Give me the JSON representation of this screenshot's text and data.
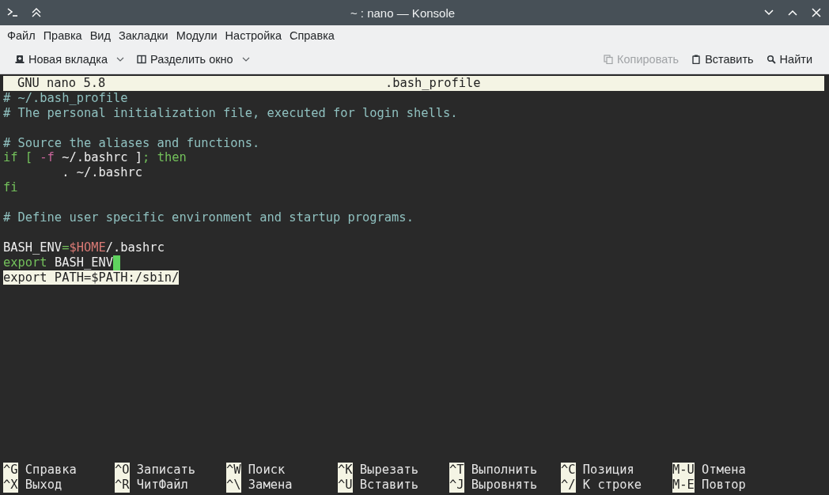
{
  "window": {
    "title": "~ : nano — Konsole"
  },
  "menu": [
    "Файл",
    "Правка",
    "Вид",
    "Закладки",
    "Модули",
    "Настройка",
    "Справка"
  ],
  "toolbar": {
    "left": [
      {
        "label": "Новая вкладка",
        "dropdown": true,
        "disabled": false
      },
      {
        "label": "Разделить окно",
        "dropdown": true,
        "disabled": false
      }
    ],
    "right": [
      {
        "label": "Копировать",
        "dropdown": false,
        "disabled": true
      },
      {
        "label": "Вставить",
        "dropdown": false,
        "disabled": false
      },
      {
        "label": "Найти",
        "dropdown": false,
        "disabled": false
      }
    ]
  },
  "nano": {
    "version": "GNU nano 5.8",
    "filename": ".bash_profile",
    "lines": [
      {
        "selected": false,
        "cursor": false,
        "segments": [
          {
            "kind": "comment",
            "text": "# ~/.bash_profile"
          }
        ]
      },
      {
        "selected": false,
        "cursor": false,
        "segments": [
          {
            "kind": "comment",
            "text": "# The personal initialization file, executed for login shells."
          }
        ]
      },
      {
        "selected": false,
        "cursor": false
      },
      {
        "selected": false,
        "cursor": false,
        "segments": [
          {
            "kind": "comment",
            "text": "# Source the aliases and functions."
          }
        ]
      },
      {
        "selected": false,
        "cursor": false,
        "segments": [
          {
            "kind": "keyword",
            "text": "if [ "
          },
          {
            "kind": "option",
            "text": "-f"
          },
          {
            "kind": "plain",
            "text": " ~/.bashrc ]"
          },
          {
            "kind": "keyword",
            "text": "; then"
          }
        ]
      },
      {
        "selected": false,
        "cursor": false,
        "segments": [
          {
            "kind": "plain",
            "text": "        . ~/.bashrc"
          }
        ]
      },
      {
        "selected": false,
        "cursor": false,
        "segments": [
          {
            "kind": "keyword",
            "text": "fi"
          }
        ]
      },
      {
        "selected": false,
        "cursor": false
      },
      {
        "selected": false,
        "cursor": false,
        "segments": [
          {
            "kind": "comment",
            "text": "# Define user specific environment and startup programs."
          }
        ]
      },
      {
        "selected": false,
        "cursor": false
      },
      {
        "selected": false,
        "cursor": false,
        "segments": [
          {
            "kind": "plain",
            "text": "BASH_ENV"
          },
          {
            "kind": "keyword",
            "text": "="
          },
          {
            "kind": "variable",
            "text": "$HOME"
          },
          {
            "kind": "plain",
            "text": "/.bashrc"
          }
        ]
      },
      {
        "selected": false,
        "cursor": true,
        "segments": [
          {
            "kind": "keyword",
            "text": "export"
          },
          {
            "kind": "plain",
            "text": " BASH_ENV"
          }
        ]
      },
      {
        "selected": true,
        "cursor": false,
        "segments": [
          {
            "kind": "plain",
            "text": "export PATH=$PATH:/sbin/"
          }
        ]
      }
    ],
    "shortcuts": [
      {
        "key": "^G",
        "label": "Справка"
      },
      {
        "key": "^O",
        "label": "Записать"
      },
      {
        "key": "^W",
        "label": "Поиск"
      },
      {
        "key": "^K",
        "label": "Вырезать"
      },
      {
        "key": "^T",
        "label": "Выполнить"
      },
      {
        "key": "^C",
        "label": "Позиция"
      },
      {
        "key": "M-U",
        "label": "Отмена"
      },
      {
        "key": "^X",
        "label": "Выход"
      },
      {
        "key": "^R",
        "label": "ЧитФайл"
      },
      {
        "key": "^\\",
        "label": "Замена"
      },
      {
        "key": "^U",
        "label": "Вставить"
      },
      {
        "key": "^J",
        "label": "Выровнять"
      },
      {
        "key": "^/",
        "label": "К строке"
      },
      {
        "key": "M-E",
        "label": "Повтор"
      }
    ]
  }
}
